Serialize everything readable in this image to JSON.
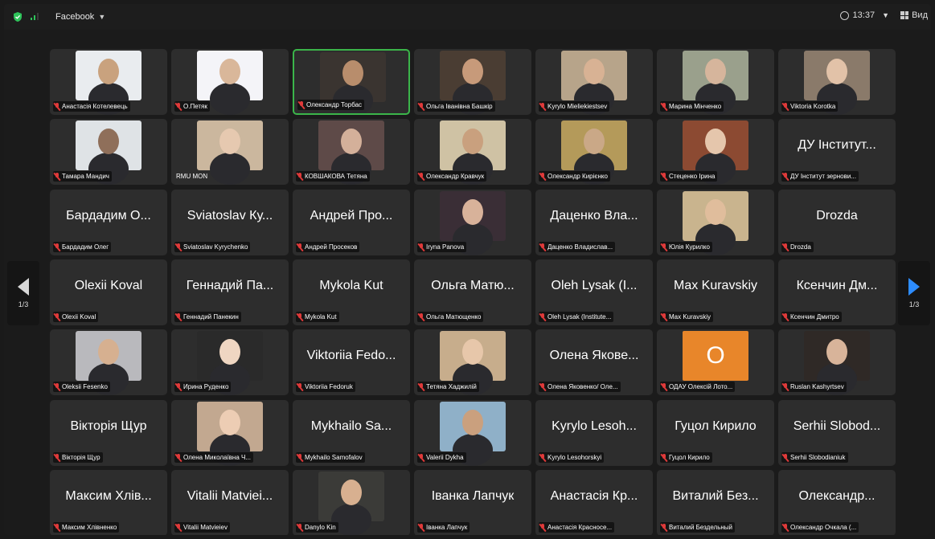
{
  "topbar": {
    "app_name": "Facebook",
    "time": "13:37",
    "view_label": "Вид"
  },
  "pagination": {
    "left": "1/3",
    "right": "1/3"
  },
  "tiles": [
    {
      "big": "",
      "label": "Анастасія Котелевець",
      "video": true,
      "bg": "#e9ecef",
      "skin": "#c9a27e"
    },
    {
      "big": "",
      "label": "О.Петяк",
      "video": true,
      "bg": "#f4f4f8",
      "skin": "#d9b79a"
    },
    {
      "big": "",
      "label": "Олександр Торбас",
      "video": true,
      "bg": "#3a3430",
      "skin": "#b88d6c",
      "active": true
    },
    {
      "big": "",
      "label": "Ольга Іванівна Башкір",
      "video": true,
      "bg": "#4a3d33",
      "skin": "#c79a7a"
    },
    {
      "big": "",
      "label": "Kyrylo Mieliekiestsev",
      "video": true,
      "bg": "#b7a48a",
      "skin": "#d8b294"
    },
    {
      "big": "",
      "label": "Марина Мінченко",
      "video": true,
      "bg": "#9aa08c",
      "skin": "#d6b59c"
    },
    {
      "big": "",
      "label": "Viktoria Korotka",
      "video": true,
      "bg": "#8a7a6a",
      "skin": "#e2c2a8"
    },
    {
      "big": "",
      "label": "Тамара Мандич",
      "video": true,
      "bg": "#dfe3e6",
      "skin": "#8f6f5a"
    },
    {
      "big": "",
      "label": "RMU MON",
      "video": true,
      "bg": "#cbb79e",
      "skin": "#e6c9b0",
      "plain": true
    },
    {
      "big": "",
      "label": "КОВШАКОВА Тетяна",
      "video": true,
      "bg": "#5e4a48",
      "skin": "#d4b09a"
    },
    {
      "big": "",
      "label": "Олександр Кравчук",
      "video": true,
      "bg": "#cfc2a4",
      "skin": "#c9a07e"
    },
    {
      "big": "",
      "label": "Олександр Кирієнко",
      "video": true,
      "bg": "#b49a5a",
      "skin": "#caa887"
    },
    {
      "big": "",
      "label": "Стеценко Ірина",
      "video": true,
      "bg": "#8c4a32",
      "skin": "#e5c6ac"
    },
    {
      "big": "ДУ Інститут...",
      "label": "ДУ Інститут зернови...",
      "video": false
    },
    {
      "big": "Бардадим О...",
      "label": "Бардадим Олег",
      "video": false
    },
    {
      "big": "Sviatoslav Ку...",
      "label": "Sviatoslav Kyrychenko",
      "video": false
    },
    {
      "big": "Андрей Про...",
      "label": "Андрей Просеков",
      "video": false
    },
    {
      "big": "",
      "label": "Iryna Panova",
      "video": true,
      "bg": "#3a2e36",
      "skin": "#d8b29a"
    },
    {
      "big": "Даценко Вла...",
      "label": "Даценко Владислав...",
      "video": false
    },
    {
      "big": "",
      "label": "Юлія Курилко",
      "video": true,
      "bg": "#c9b48e",
      "skin": "#e0bd9c"
    },
    {
      "big": "Drozda",
      "label": "Drozda",
      "video": false
    },
    {
      "big": "Olexii Koval",
      "label": "Olexii Koval",
      "video": false
    },
    {
      "big": "Геннадий Па...",
      "label": "Геннадий Панекин",
      "video": false
    },
    {
      "big": "Mykola Kut",
      "label": "Mykola Kut",
      "video": false
    },
    {
      "big": "Ольга Матю...",
      "label": "Ольга Матющенко",
      "video": false
    },
    {
      "big": "Oleh Lysak (I...",
      "label": "Oleh Lysak (Institute...",
      "video": false
    },
    {
      "big": "Max Kuravskiy",
      "label": "Max Kuravskiy",
      "video": false
    },
    {
      "big": "Ксенчин Дм...",
      "label": "Ксенчин Дмитро",
      "video": false
    },
    {
      "big": "",
      "label": "Oleksii Fesenko",
      "video": true,
      "bg": "#b9b9bd",
      "skin": "#d6b090"
    },
    {
      "big": "",
      "label": "Ирина Руденко",
      "video": true,
      "bg": "#2a2a2a",
      "skin": "#efd6c2"
    },
    {
      "big": "Viktoriia Fedo...",
      "label": "Viktoriia Fedoruk",
      "video": false
    },
    {
      "big": "",
      "label": "Тетяна Хаджилій",
      "video": true,
      "bg": "#c7ad8c",
      "skin": "#e7c7aa"
    },
    {
      "big": "Олена Якове...",
      "label": "Олена Яковенко/ Оле...",
      "video": false
    },
    {
      "big": "",
      "label": "ОДАУ Олексій Лото...",
      "video": false,
      "orange": "O"
    },
    {
      "big": "",
      "label": "Ruslan Kashyrtsev",
      "video": true,
      "bg": "#2f2926",
      "skin": "#d8b49a"
    },
    {
      "big": "Вікторія Щур",
      "label": "Вікторія Щур",
      "video": false
    },
    {
      "big": "",
      "label": "Олена Миколаївна Ч...",
      "video": true,
      "bg": "#c2a890",
      "skin": "#edcdb4"
    },
    {
      "big": "Mykhailo Sa...",
      "label": "Mykhailo Samofalov",
      "video": false
    },
    {
      "big": "",
      "label": "Valerii Dykha",
      "video": true,
      "bg": "#8fb0c8",
      "skin": "#caa07e"
    },
    {
      "big": "Kyrylo Lesoh...",
      "label": "Kyrylo Lesohorskyi",
      "video": false
    },
    {
      "big": "Гуцол Кирило",
      "label": "Гуцол Кирило",
      "video": false
    },
    {
      "big": "Serhii Slobod...",
      "label": "Serhii Slobodianiuk",
      "video": false
    },
    {
      "big": "Максим Хлів...",
      "label": "Максим Хлівненко",
      "video": false
    },
    {
      "big": "Vitalii Matviei...",
      "label": "Vitalii Matvieiev",
      "video": false
    },
    {
      "big": "",
      "label": "Danylo Kin",
      "video": true,
      "bg": "#3b3b38",
      "skin": "#d8b090"
    },
    {
      "big": "Іванка Лапчук",
      "label": "Іванка Лапчук",
      "video": false
    },
    {
      "big": "Анастасія Кр...",
      "label": "Анастасія Красносе...",
      "video": false
    },
    {
      "big": "Виталий Без...",
      "label": "Виталий Бездельный",
      "video": false
    },
    {
      "big": "Олександр...",
      "label": "Олександр Очкала (...",
      "video": false
    }
  ]
}
